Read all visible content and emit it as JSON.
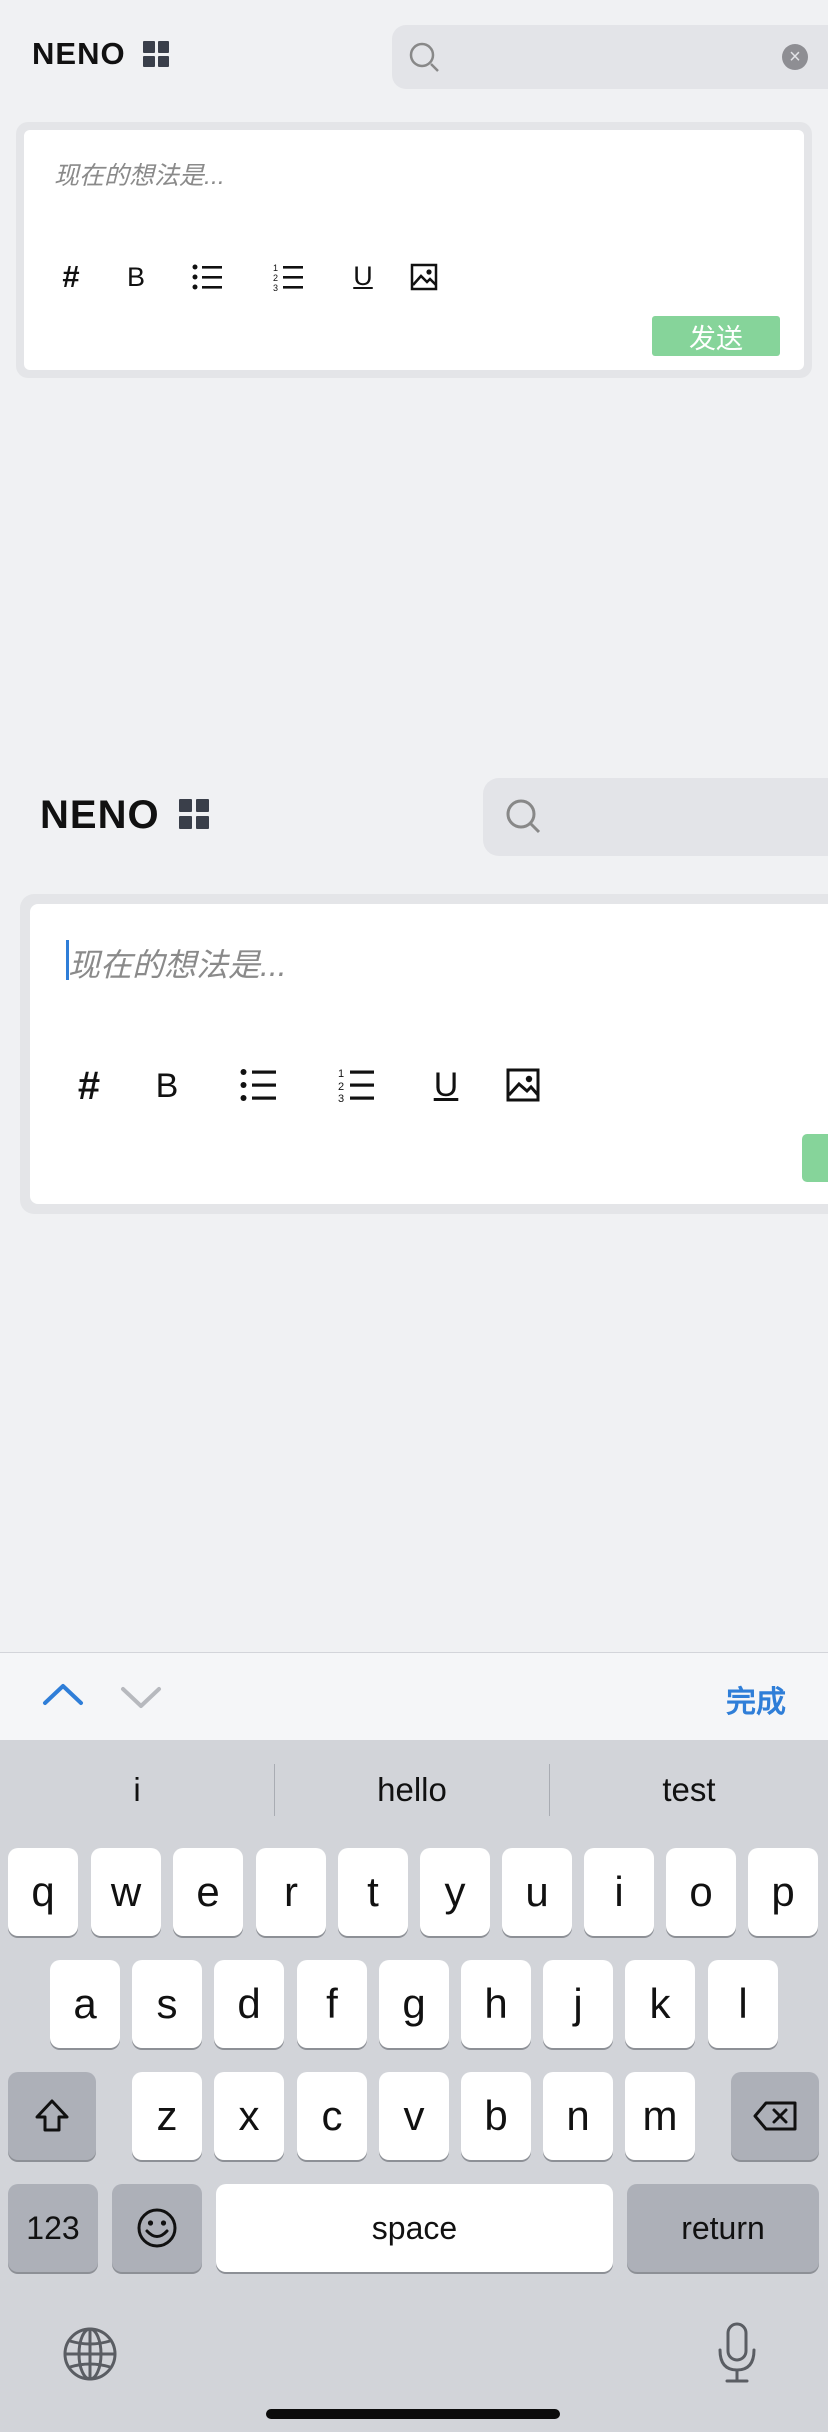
{
  "app": {
    "brand": "NENO"
  },
  "editor": {
    "placeholder": "现在的想法是...",
    "toolbar": {
      "tag": "#",
      "bold": "B",
      "underline": "U"
    },
    "send_label": "发送"
  },
  "accessory": {
    "done_label": "完成"
  },
  "keyboard": {
    "suggestions": [
      "i",
      "hello",
      "test"
    ],
    "row1": [
      "q",
      "w",
      "e",
      "r",
      "t",
      "y",
      "u",
      "i",
      "o",
      "p"
    ],
    "row2": [
      "a",
      "s",
      "d",
      "f",
      "g",
      "h",
      "j",
      "k",
      "l"
    ],
    "row3": [
      "z",
      "x",
      "c",
      "v",
      "b",
      "n",
      "m"
    ],
    "numbers_label": "123",
    "space_label": "space",
    "return_label": "return"
  },
  "colors": {
    "accent": "#86d49a",
    "link": "#2f7ed8",
    "keyboard_bg": "#d2d4d9"
  }
}
